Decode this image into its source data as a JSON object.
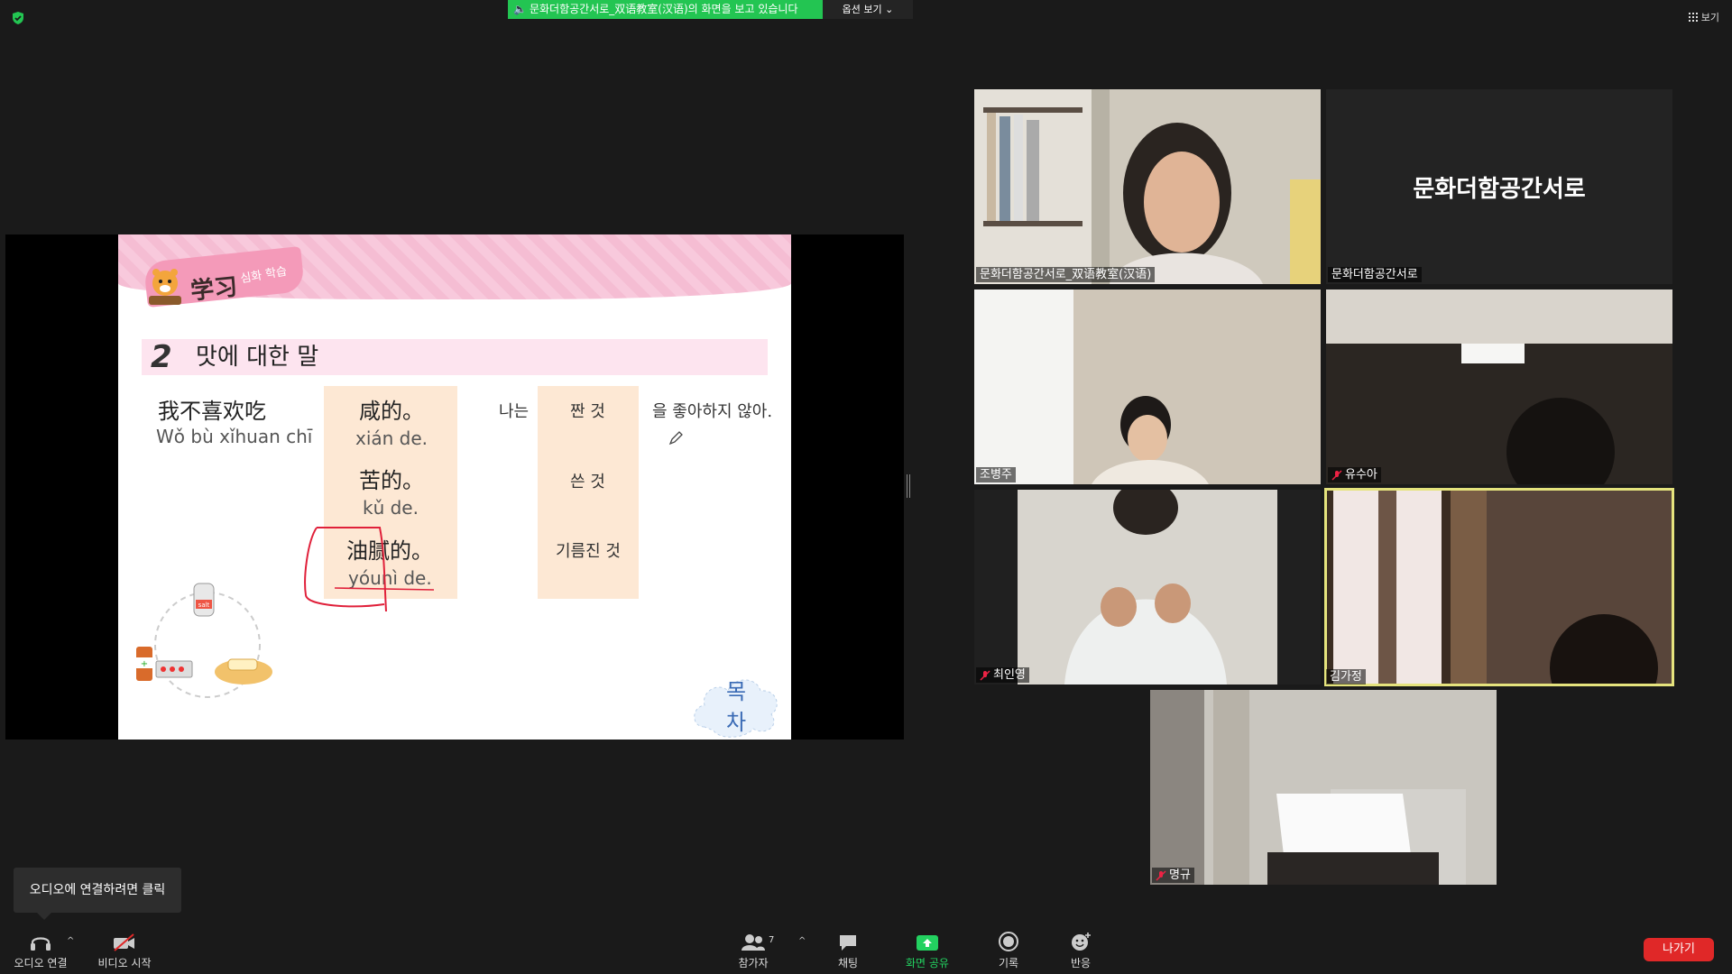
{
  "topbar": {
    "share_banner": "문화더함공간서로_双语教室(汉语)의 화면을 보고 있습니다",
    "view_options": "옵션 보기",
    "gallery_view": "보기"
  },
  "slide": {
    "tag_title": "学习",
    "tag_sub": "심화 학습",
    "section_num": "2",
    "section_title": "맛에 대한 말",
    "phrase_zh": "我不喜欢吃",
    "phrase_py": "Wǒ bù xǐhuan chī",
    "options": [
      {
        "zh": "咸的。",
        "py": "xián de.",
        "kr": "짠 것"
      },
      {
        "zh": "苦的。",
        "py": "kǔ de.",
        "kr": "쓴 것"
      },
      {
        "zh": "油腻的。",
        "py": "yóunì de.",
        "kr": "기름진 것"
      }
    ],
    "subject_kr": "나는",
    "ending_kr": "을 좋아하지 않아.",
    "toc_button": "목 차",
    "salt_label": "salt"
  },
  "participants": [
    {
      "name": "문화더함공간서로_双语教室(汉语)",
      "muted": false
    },
    {
      "name": "문화더함공간서로",
      "muted": false,
      "display_name": "문화더함공간서로"
    },
    {
      "name": "조병주",
      "muted": false
    },
    {
      "name": "유수아",
      "muted": true
    },
    {
      "name": "최인영",
      "muted": true
    },
    {
      "name": "김가정",
      "muted": false
    },
    {
      "name": "명규",
      "muted": true
    }
  ],
  "tooltip": "오디오에 연결하려면 클릭",
  "toolbar": {
    "audio": "오디오 연결",
    "video": "비디오 시작",
    "participants": "참가자",
    "participants_count": "7",
    "chat": "채팅",
    "share": "화면 공유",
    "record": "기록",
    "reactions": "반응",
    "leave": "나가기"
  },
  "colors": {
    "share_green": "#23c552",
    "active_speaker": "#e5e37d",
    "leave_red": "#e02828",
    "slide_pink": "#f8c9dc"
  }
}
